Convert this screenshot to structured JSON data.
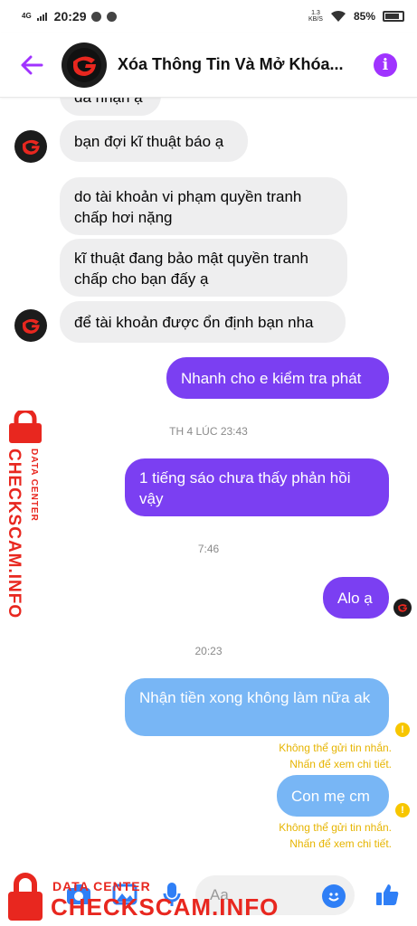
{
  "status_bar": {
    "network": "4G",
    "time": "20:29",
    "speed_top": "1.3",
    "speed_bottom": "KB/S",
    "battery": "85%",
    "battery_level": 0.85
  },
  "header": {
    "title": "Xóa Thông Tin Và Mở Khóa...",
    "accent_color": "#a033ff"
  },
  "messages": [
    {
      "dir": "in",
      "text": "đã nhận ạ"
    },
    {
      "dir": "in",
      "text": "bạn đợi kĩ thuật báo ạ"
    },
    {
      "dir": "in",
      "text": "do tài khoản vi phạm quyền tranh chấp hơi nặng"
    },
    {
      "dir": "in",
      "text": "kĩ thuật đang bảo mật quyền tranh chấp cho bạn đấy ạ"
    },
    {
      "dir": "in",
      "text": "để tài khoản được ổn định bạn nha"
    },
    {
      "dir": "out",
      "text": "Nhanh cho e kiểm tra phát"
    },
    {
      "dir": "out",
      "text": "1 tiếng sáo chưa thấy phản hồi vậy"
    },
    {
      "dir": "out",
      "text": "Alo ạ"
    },
    {
      "dir": "out-failed",
      "text": "Nhận tiền xong không làm nữa ak"
    },
    {
      "dir": "out-failed",
      "text": "Con mẹ cm"
    }
  ],
  "timestamps": [
    "TH 4 LÚC 23:43",
    "7:46",
    "20:23"
  ],
  "errors": [
    {
      "line1": "Không thể gửi tin nhắn.",
      "line2": "Nhấn để xem chi tiết."
    },
    {
      "line1": "Không thể gửi tin nhắn.",
      "line2": "Nhấn để xem chi tiết."
    }
  ],
  "composer": {
    "placeholder": "Aa"
  },
  "watermark": {
    "top": "DATA CENTER",
    "main": "CHECKSCAM.INFO",
    "color": "#e8271f"
  },
  "icons": [
    "back-arrow-icon",
    "info-icon",
    "camera-icon",
    "image-icon",
    "microphone-icon",
    "emoji-icon",
    "thumbs-up-icon",
    "warning-icon",
    "lock-icon"
  ]
}
